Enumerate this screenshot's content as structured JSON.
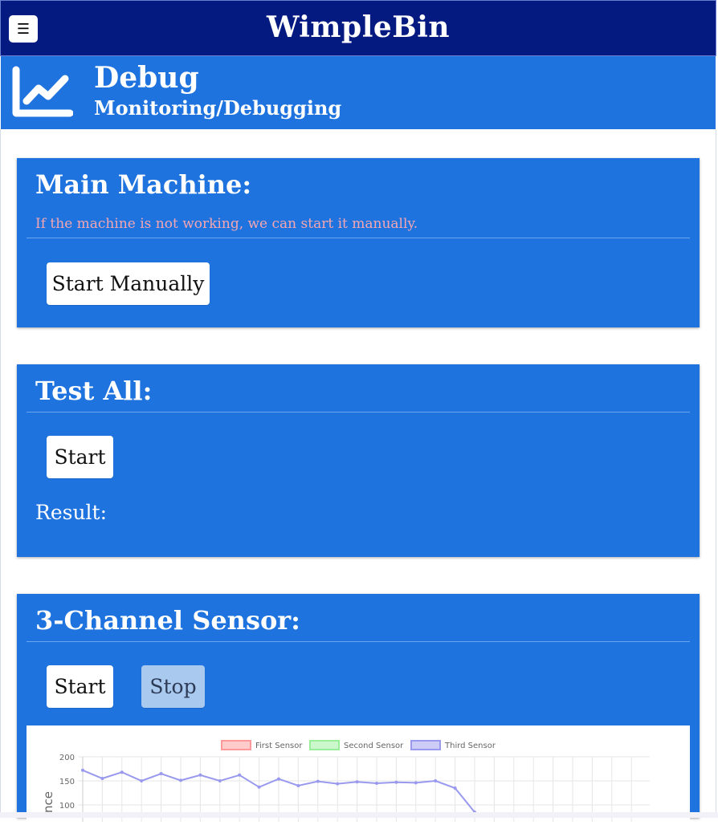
{
  "header": {
    "menu_icon": "☰",
    "title": "WimpleBin"
  },
  "page": {
    "icon": "line-chart-icon",
    "title": "Debug",
    "subtitle": "Monitoring/Debugging"
  },
  "main_machine": {
    "title": "Main Machine:",
    "note": "If the machine is not working, we can start it manually.",
    "button_label": "Start Manually"
  },
  "test_all": {
    "title": "Test All:",
    "button_label": "Start",
    "result_label": "Result:"
  },
  "sensor": {
    "title": "3-Channel Sensor:",
    "start_label": "Start",
    "stop_label": "Stop"
  },
  "colors": {
    "header_bg": "#041a80",
    "accent": "#1e73df",
    "note_text": "#f4a6b2"
  },
  "chart_data": {
    "type": "line",
    "legend": [
      {
        "name": "First Sensor",
        "color": "#ff9999"
      },
      {
        "name": "Second Sensor",
        "color": "#99ee99"
      },
      {
        "name": "Third Sensor",
        "color": "#9999ee"
      }
    ],
    "ylabel": "nce",
    "yticks": [
      200,
      150,
      100
    ],
    "ylim": [
      80,
      200
    ],
    "grid": true,
    "legend_position": "top",
    "series": [
      {
        "name": "Third Sensor",
        "values": [
          172,
          155,
          168,
          150,
          165,
          151,
          162,
          150,
          162,
          137,
          154,
          140,
          149,
          144,
          148,
          145,
          147,
          146,
          150,
          135,
          85
        ]
      }
    ]
  }
}
